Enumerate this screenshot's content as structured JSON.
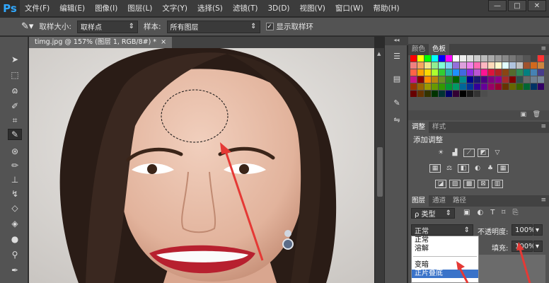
{
  "menubar": {
    "app_logo": "Ps",
    "items": [
      "文件(F)",
      "编辑(E)",
      "图像(I)",
      "图层(L)",
      "文字(Y)",
      "选择(S)",
      "滤镜(T)",
      "3D(D)",
      "视图(V)",
      "窗口(W)",
      "帮助(H)"
    ],
    "window_controls": [
      "—",
      "□",
      "✕"
    ]
  },
  "options": {
    "sample_size_label": "取样大小:",
    "sample_size_value": "取样点",
    "sample_label": "样本:",
    "sample_value": "所有图层",
    "show_ring_label": "显示取样环",
    "show_ring_checked": true
  },
  "document": {
    "tab_title": "timg.jpg @ 157% (图层 1, RGB/8#) *",
    "close": "×"
  },
  "panels": {
    "color_tabs": [
      "颜色",
      "色板"
    ],
    "adjust_tabs": [
      "调整",
      "样式"
    ],
    "add_adjustment": "添加调整",
    "layer_tabs": [
      "图层",
      "通道",
      "路径"
    ],
    "filter_kind": "ρ 类型",
    "blend_mode": "正常",
    "opacity_label": "不透明度:",
    "opacity_value": "100%",
    "fill_label": "填充:",
    "fill_value": "100%",
    "blend_options": [
      "正常",
      "溶解",
      "变暗",
      "正片叠底"
    ],
    "selected_blend": "正片叠底"
  },
  "colors": {
    "arrow": "#e53935",
    "ps_blue": "#31a8ff",
    "selection": "#3a73c9"
  }
}
